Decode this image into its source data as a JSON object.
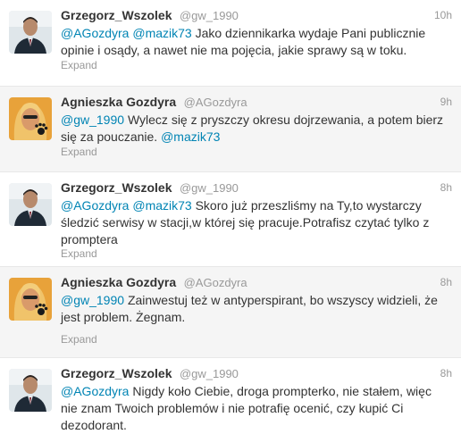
{
  "tweets": [
    {
      "fullname": "Grzegorz_Wszolek",
      "username": "@gw_1990",
      "time": "10h",
      "avatar_icon": "man-portrait-avatar",
      "mentions": [
        "@AGozdyra",
        "@mazik73"
      ],
      "text": "Jako dziennikarka wydaje Pani publicznie opinie i osądy, a nawet nie ma pojęcia, jakie sprawy są w toku.",
      "expand": "Expand"
    },
    {
      "fullname": "Agnieszka Gozdyra",
      "username": "@AGozdyra",
      "time": "9h",
      "avatar_icon": "woman-paw-avatar",
      "mention1": "@gw_1990",
      "text_main": "Wylecz się z pryszczy okresu dojrzewania, a potem bierz się za pouczanie.",
      "mention2": "@mazik73",
      "expand": "Expand"
    },
    {
      "fullname": "Grzegorz_Wszolek",
      "username": "@gw_1990",
      "time": "8h",
      "avatar_icon": "man-portrait-avatar",
      "mentions": [
        "@AGozdyra",
        "@mazik73"
      ],
      "text": "Skoro już przeszliśmy na Ty,to wystarczy śledzić serwisy w stacji,w której się pracuje.Potrafisz czytać tylko z promptera",
      "expand": "Expand"
    },
    {
      "fullname": "Agnieszka Gozdyra",
      "username": "@AGozdyra",
      "time": "8h",
      "avatar_icon": "woman-paw-avatar",
      "mention1": "@gw_1990",
      "text": "Zainwestuj też w antyperspirant, bo wszyscy widzieli, że jest problem. Żegnam.",
      "expand": "Expand"
    },
    {
      "fullname": "Grzegorz_Wszolek",
      "username": "@gw_1990",
      "time": "8h",
      "avatar_icon": "man-portrait-avatar",
      "mention1": "@AGozdyra",
      "text": "Nigdy koło Ciebie, droga prompterko, nie stałem, więc nie znam Twoich problemów i nie potrafię ocenić, czy kupić Ci dezodorant."
    }
  ],
  "colors": {
    "mention": "#0084b4",
    "muted": "#999999",
    "text": "#333333",
    "alt_bg": "#f5f5f5"
  }
}
